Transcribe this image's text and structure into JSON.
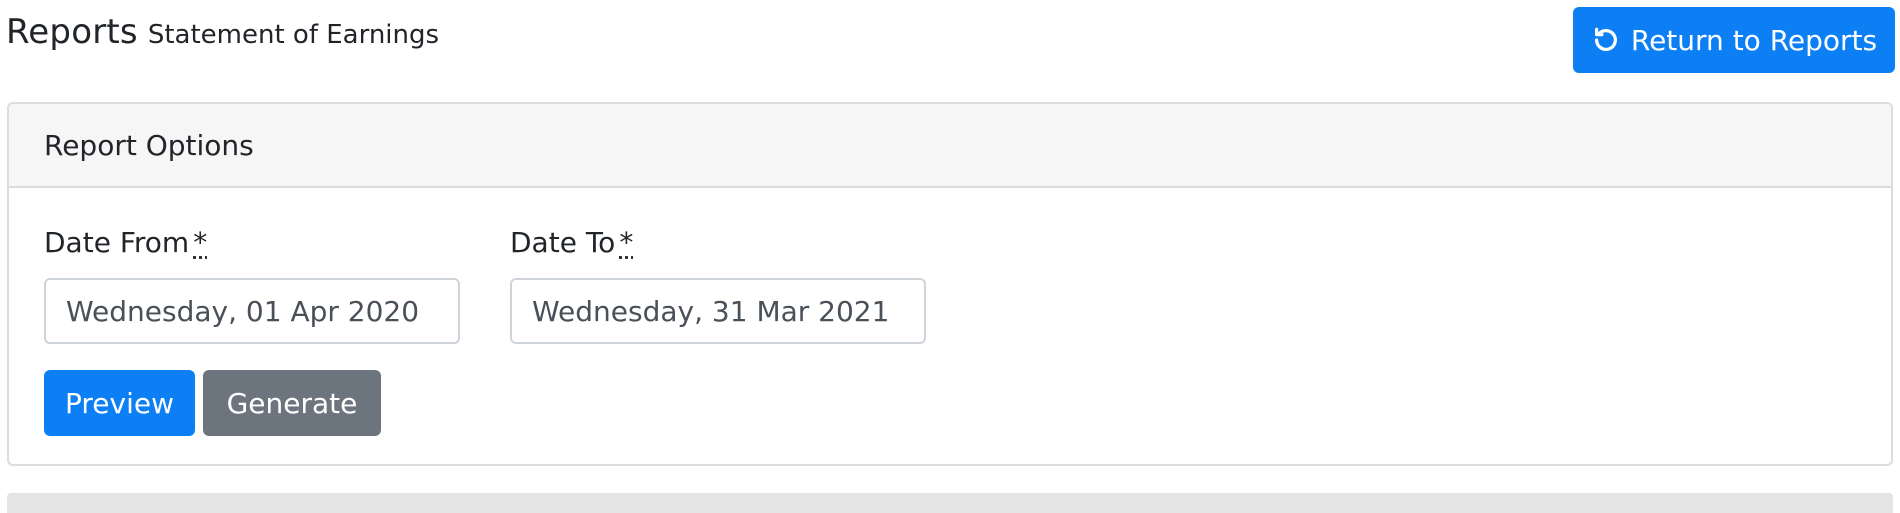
{
  "header": {
    "title": "Reports",
    "subtitle": "Statement of Earnings",
    "return_button": {
      "label": "Return to Reports",
      "icon": "undo-arrow-icon"
    }
  },
  "report_options": {
    "title": "Report Options",
    "date_from": {
      "label": "Date From",
      "required_marker": "*",
      "value": "Wednesday, 01 Apr 2020"
    },
    "date_to": {
      "label": "Date To",
      "required_marker": "*",
      "value": "Wednesday, 31 Mar 2021"
    },
    "buttons": {
      "preview": "Preview",
      "generate": "Generate"
    }
  },
  "colors": {
    "primary": "#0d7ff5",
    "secondary": "#6c757d",
    "card_header_bg": "#f6f6f6",
    "border": "#dcdcdc"
  }
}
